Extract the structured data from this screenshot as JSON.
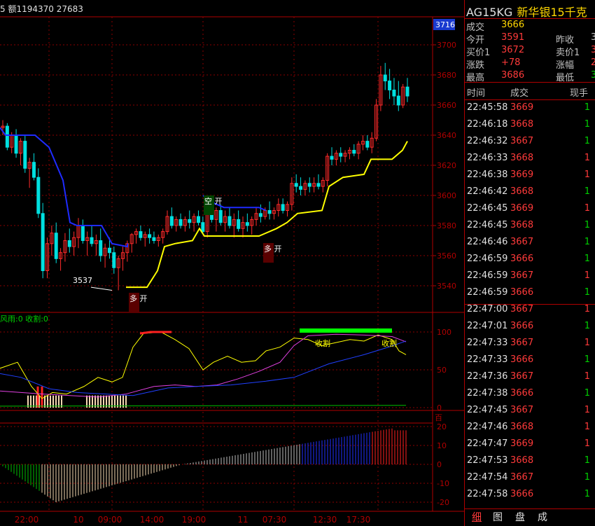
{
  "top_info": "5 额1194370 27683",
  "symbol": {
    "code": "AG15KG",
    "name": "新华银15千克"
  },
  "quote": {
    "volume_label": "成交",
    "volume": "3666",
    "open_label": "今开",
    "open": "3591",
    "prev_label": "昨收",
    "prev": "3",
    "bid_label": "买价1",
    "bid": "3672",
    "ask_label": "卖价1",
    "ask": "3",
    "change_label": "涨跌",
    "change": "+78",
    "pct_label": "涨幅",
    "pct": "2",
    "high_label": "最高",
    "high": "3686",
    "low_label": "最低",
    "low": "3"
  },
  "tick_header": {
    "time": "时间",
    "price": "成交",
    "vol": "现手"
  },
  "ticks": [
    {
      "time": "22:45:58",
      "price": "3669",
      "vol": "1",
      "color": "green"
    },
    {
      "time": "22:46:18",
      "price": "3668",
      "vol": "1",
      "color": "green"
    },
    {
      "time": "22:46:32",
      "price": "3667",
      "vol": "1",
      "color": "green"
    },
    {
      "time": "22:46:33",
      "price": "3668",
      "vol": "1",
      "color": "red"
    },
    {
      "time": "22:46:38",
      "price": "3669",
      "vol": "1",
      "color": "red"
    },
    {
      "time": "22:46:42",
      "price": "3668",
      "vol": "1",
      "color": "green"
    },
    {
      "time": "22:46:45",
      "price": "3669",
      "vol": "1",
      "color": "red"
    },
    {
      "time": "22:46:45",
      "price": "3668",
      "vol": "1",
      "color": "green"
    },
    {
      "time": "22:46:46",
      "price": "3667",
      "vol": "1",
      "color": "green"
    },
    {
      "time": "22:46:59",
      "price": "3666",
      "vol": "1",
      "color": "green"
    },
    {
      "time": "22:46:59",
      "price": "3667",
      "vol": "1",
      "color": "red"
    },
    {
      "time": "22:46:59",
      "price": "3666",
      "vol": "1",
      "color": "green"
    },
    {
      "time": "22:47:00",
      "price": "3667",
      "vol": "1",
      "color": "red"
    },
    {
      "time": "22:47:01",
      "price": "3666",
      "vol": "1",
      "color": "green"
    },
    {
      "time": "22:47:33",
      "price": "3667",
      "vol": "1",
      "color": "red"
    },
    {
      "time": "22:47:33",
      "price": "3666",
      "vol": "1",
      "color": "green"
    },
    {
      "time": "22:47:36",
      "price": "3667",
      "vol": "1",
      "color": "red"
    },
    {
      "time": "22:47:38",
      "price": "3666",
      "vol": "1",
      "color": "green"
    },
    {
      "time": "22:47:45",
      "price": "3667",
      "vol": "1",
      "color": "red"
    },
    {
      "time": "22:47:46",
      "price": "3668",
      "vol": "1",
      "color": "red"
    },
    {
      "time": "22:47:47",
      "price": "3669",
      "vol": "1",
      "color": "red"
    },
    {
      "time": "22:47:53",
      "price": "3668",
      "vol": "1",
      "color": "green"
    },
    {
      "time": "22:47:54",
      "price": "3667",
      "vol": "1",
      "color": "green"
    },
    {
      "time": "22:47:58",
      "price": "3666",
      "vol": "1",
      "color": "green"
    }
  ],
  "tabs": [
    "细",
    "图",
    "盘",
    "成"
  ],
  "chart_data": [
    {
      "type": "candlestick",
      "y_ticks": [
        "3700",
        "3680",
        "3660",
        "3640",
        "3620",
        "3600",
        "3580",
        "3560",
        "3540"
      ],
      "current_price_box": "3716",
      "annotations": {
        "low_value": "3537",
        "buy_open_1": "多\n开",
        "short_open": "空\n开",
        "buy_open_2": "多\n开"
      },
      "ohlc": [
        [
          3645,
          3650,
          3640,
          3646
        ],
        [
          3646,
          3648,
          3630,
          3632
        ],
        [
          3632,
          3642,
          3628,
          3640
        ],
        [
          3640,
          3644,
          3625,
          3628
        ],
        [
          3628,
          3638,
          3620,
          3636
        ],
        [
          3636,
          3640,
          3615,
          3618
        ],
        [
          3618,
          3625,
          3605,
          3622
        ],
        [
          3622,
          3628,
          3610,
          3612
        ],
        [
          3612,
          3618,
          3585,
          3588
        ],
        [
          3588,
          3595,
          3545,
          3550
        ],
        [
          3550,
          3572,
          3545,
          3568
        ],
        [
          3568,
          3580,
          3560,
          3575
        ],
        [
          3575,
          3582,
          3555,
          3558
        ],
        [
          3558,
          3565,
          3550,
          3562
        ],
        [
          3562,
          3575,
          3556,
          3570
        ],
        [
          3570,
          3578,
          3562,
          3566
        ],
        [
          3566,
          3576,
          3560,
          3572
        ],
        [
          3572,
          3585,
          3565,
          3580
        ],
        [
          3580,
          3584,
          3568,
          3570
        ],
        [
          3570,
          3576,
          3560,
          3572
        ],
        [
          3572,
          3580,
          3566,
          3568
        ],
        [
          3568,
          3574,
          3560,
          3570
        ],
        [
          3570,
          3578,
          3556,
          3560
        ],
        [
          3560,
          3568,
          3552,
          3565
        ],
        [
          3565,
          3572,
          3558,
          3562
        ],
        [
          3562,
          3566,
          3548,
          3552
        ],
        [
          3552,
          3560,
          3537,
          3558
        ],
        [
          3558,
          3566,
          3550,
          3562
        ],
        [
          3562,
          3570,
          3556,
          3568
        ],
        [
          3568,
          3575,
          3562,
          3574
        ],
        [
          3574,
          3578,
          3568,
          3576
        ],
        [
          3576,
          3580,
          3570,
          3572
        ],
        [
          3572,
          3576,
          3566,
          3574
        ],
        [
          3574,
          3578,
          3568,
          3572
        ],
        [
          3572,
          3576,
          3568,
          3570
        ],
        [
          3570,
          3574,
          3566,
          3572
        ],
        [
          3572,
          3578,
          3568,
          3576
        ],
        [
          3576,
          3590,
          3574,
          3586
        ],
        [
          3586,
          3592,
          3578,
          3580
        ],
        [
          3580,
          3586,
          3576,
          3584
        ],
        [
          3584,
          3588,
          3578,
          3580
        ],
        [
          3580,
          3586,
          3576,
          3584
        ],
        [
          3584,
          3590,
          3578,
          3582
        ],
        [
          3582,
          3588,
          3576,
          3586
        ],
        [
          3586,
          3590,
          3580,
          3582
        ],
        [
          3582,
          3586,
          3574,
          3576
        ],
        [
          3576,
          3590,
          3572,
          3588
        ],
        [
          3588,
          3596,
          3582,
          3584
        ],
        [
          3584,
          3592,
          3576,
          3590
        ],
        [
          3590,
          3594,
          3580,
          3582
        ],
        [
          3582,
          3590,
          3576,
          3586
        ],
        [
          3586,
          3592,
          3578,
          3580
        ],
        [
          3580,
          3588,
          3572,
          3584
        ],
        [
          3584,
          3590,
          3576,
          3578
        ],
        [
          3578,
          3586,
          3572,
          3582
        ],
        [
          3582,
          3588,
          3576,
          3580
        ],
        [
          3580,
          3586,
          3574,
          3584
        ],
        [
          3584,
          3592,
          3580,
          3588
        ],
        [
          3588,
          3594,
          3582,
          3586
        ],
        [
          3586,
          3592,
          3584,
          3590
        ],
        [
          3590,
          3596,
          3584,
          3588
        ],
        [
          3588,
          3592,
          3584,
          3590
        ],
        [
          3590,
          3598,
          3586,
          3594
        ],
        [
          3594,
          3598,
          3588,
          3590
        ],
        [
          3590,
          3596,
          3586,
          3594
        ],
        [
          3594,
          3612,
          3590,
          3608
        ],
        [
          3608,
          3614,
          3602,
          3606
        ],
        [
          3606,
          3612,
          3600,
          3604
        ],
        [
          3604,
          3610,
          3600,
          3608
        ],
        [
          3608,
          3612,
          3602,
          3606
        ],
        [
          3606,
          3612,
          3602,
          3608
        ],
        [
          3608,
          3614,
          3604,
          3606
        ],
        [
          3606,
          3612,
          3602,
          3610
        ],
        [
          3610,
          3628,
          3606,
          3626
        ],
        [
          3626,
          3632,
          3620,
          3624
        ],
        [
          3624,
          3630,
          3620,
          3628
        ],
        [
          3628,
          3632,
          3622,
          3626
        ],
        [
          3626,
          3630,
          3622,
          3628
        ],
        [
          3628,
          3632,
          3624,
          3630
        ],
        [
          3630,
          3634,
          3626,
          3628
        ],
        [
          3628,
          3636,
          3624,
          3634
        ],
        [
          3634,
          3640,
          3630,
          3636
        ],
        [
          3636,
          3640,
          3630,
          3632
        ],
        [
          3632,
          3642,
          3628,
          3638
        ],
        [
          3638,
          3664,
          3636,
          3660
        ],
        [
          3660,
          3686,
          3656,
          3680
        ],
        [
          3680,
          3688,
          3670,
          3676
        ],
        [
          3676,
          3684,
          3664,
          3670
        ],
        [
          3670,
          3678,
          3660,
          3666
        ],
        [
          3666,
          3676,
          3656,
          3660
        ],
        [
          3660,
          3674,
          3658,
          3672
        ],
        [
          3672,
          3678,
          3662,
          3666
        ]
      ]
    },
    {
      "type": "line",
      "legend": "风雨:0 收割:0",
      "y_ticks": [
        "100",
        "50",
        "0"
      ],
      "annotations": [
        "收割",
        "收割"
      ]
    },
    {
      "type": "bar",
      "y_ticks": [
        "20",
        "10",
        "0",
        "-10",
        "-20"
      ],
      "unit_label": "百"
    }
  ],
  "x_axis_labels": [
    "22:00",
    "10",
    "09:00",
    "14:00",
    "19:00",
    "11",
    "07:30",
    "12:30",
    "17:30"
  ],
  "colors": {
    "up": "#ff2a2a",
    "down": "#00e0e0",
    "grid": "#8b0000",
    "axis": "#b00000"
  }
}
